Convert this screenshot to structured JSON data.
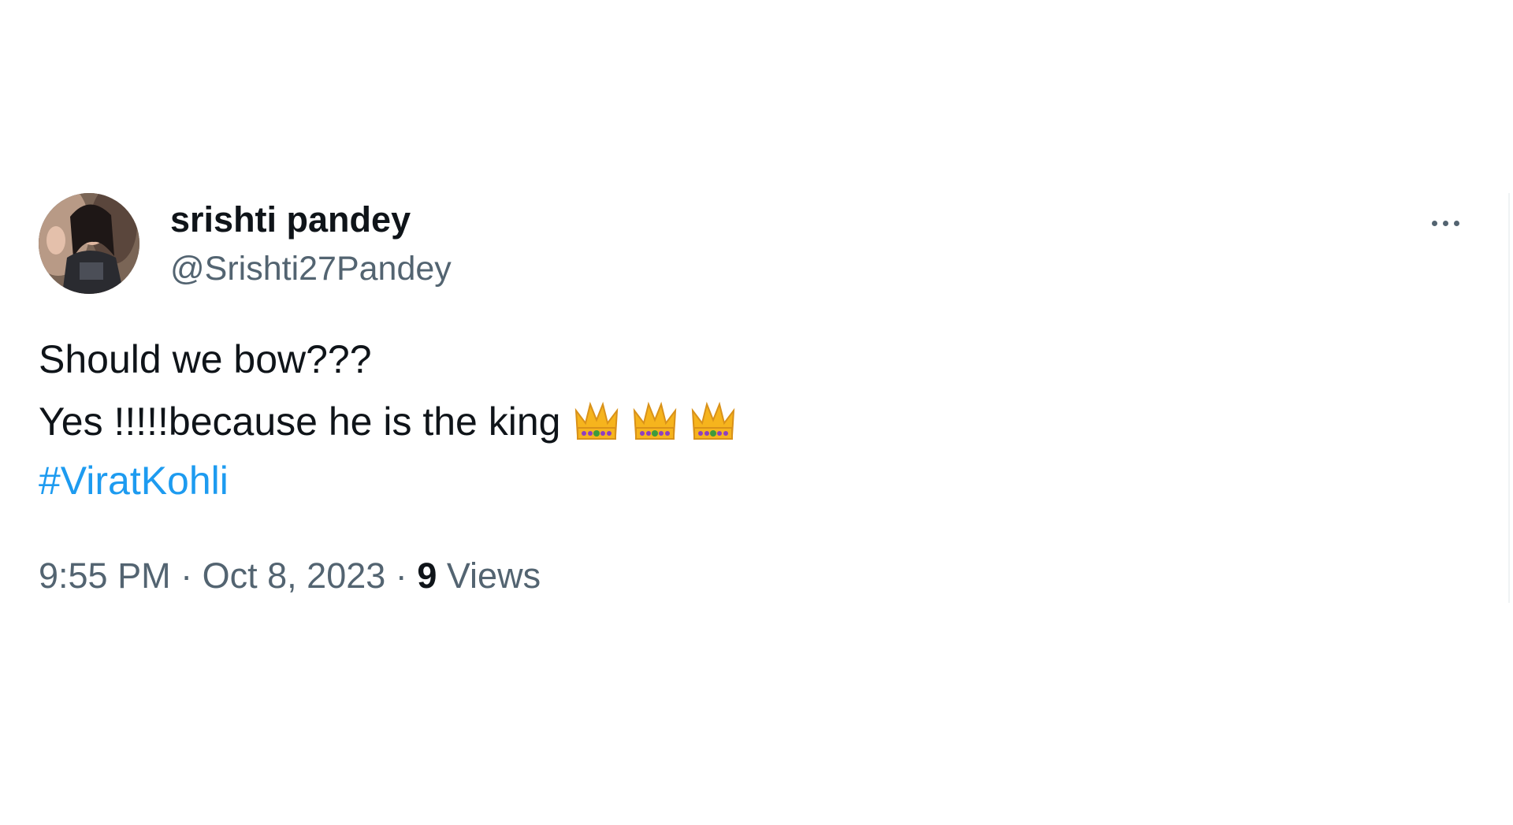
{
  "tweet": {
    "author": {
      "display_name": "srishti pandey",
      "handle": "@Srishti27Pandey",
      "avatar_icon": "profile-photo"
    },
    "text_line_1": "Should we bow???",
    "text_line_2": "Yes !!!!!because he is the king",
    "emoji": [
      "crown",
      "crown",
      "crown"
    ],
    "hashtag": "#ViratKohli",
    "time": "9:55 PM",
    "separator": "·",
    "date": "Oct 8, 2023",
    "views_count": "9",
    "views_label": "Views",
    "more_icon": "more-horizontal-icon"
  },
  "colors": {
    "text": "#0f1419",
    "secondary": "#536471",
    "link": "#1d9bf0"
  }
}
